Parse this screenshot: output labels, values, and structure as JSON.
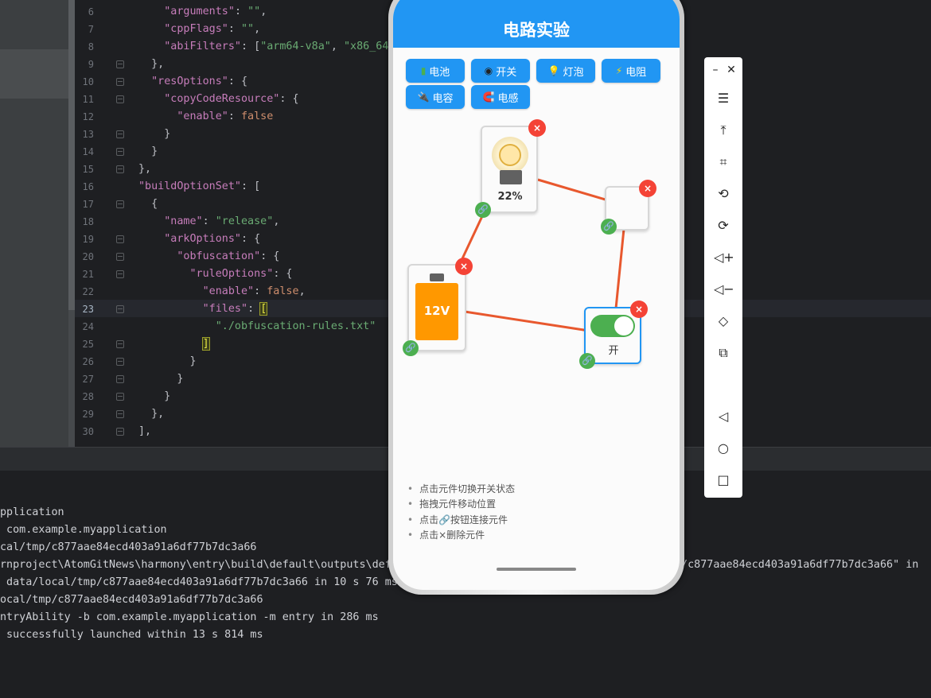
{
  "ide": {
    "code_lines": [
      {
        "n": "6",
        "html": "    <span class=\"k\">\"arguments\"</span><span class=\"p\">: </span><span class=\"s\">\"\"</span><span class=\"p\">,</span>"
      },
      {
        "n": "7",
        "html": "    <span class=\"k\">\"cppFlags\"</span><span class=\"p\">: </span><span class=\"s\">\"\"</span><span class=\"p\">,</span>"
      },
      {
        "n": "8",
        "html": "    <span class=\"k\">\"abiFilters\"</span><span class=\"p\">: [</span><span class=\"s\">\"arm64-v8a\"</span><span class=\"p\">, </span><span class=\"s\">\"x86_64</span>"
      },
      {
        "n": "9",
        "html": "  <span class=\"p\">},</span>"
      },
      {
        "n": "10",
        "html": "  <span class=\"k\">\"resOptions\"</span><span class=\"p\">: {</span>"
      },
      {
        "n": "11",
        "html": "    <span class=\"k\">\"copyCodeResource\"</span><span class=\"p\">: {</span>"
      },
      {
        "n": "12",
        "html": "      <span class=\"k\">\"enable\"</span><span class=\"p\">: </span><span class=\"b\">false</span>"
      },
      {
        "n": "13",
        "html": "    <span class=\"p\">}</span>"
      },
      {
        "n": "14",
        "html": "  <span class=\"p\">}</span>"
      },
      {
        "n": "15",
        "html": "<span class=\"p\">},</span>"
      },
      {
        "n": "16",
        "html": "<span class=\"k\">\"buildOptionSet\"</span><span class=\"p\">: [</span>"
      },
      {
        "n": "17",
        "html": "  <span class=\"p\">{</span>"
      },
      {
        "n": "18",
        "html": "    <span class=\"k\">\"name\"</span><span class=\"p\">: </span><span class=\"s\">\"release\"</span><span class=\"p\">,</span>"
      },
      {
        "n": "19",
        "html": "    <span class=\"k\">\"arkOptions\"</span><span class=\"p\">: {</span>"
      },
      {
        "n": "20",
        "html": "      <span class=\"k\">\"obfuscation\"</span><span class=\"p\">: {</span>"
      },
      {
        "n": "21",
        "html": "        <span class=\"k\">\"ruleOptions\"</span><span class=\"p\">: {</span>"
      },
      {
        "n": "22",
        "html": "          <span class=\"k\">\"enable\"</span><span class=\"p\">: </span><span class=\"b\">false</span><span class=\"p\">,</span>"
      },
      {
        "n": "23",
        "html": "          <span class=\"k\">\"files\"</span><span class=\"p\">: </span><span class=\"mark\">[</span>"
      },
      {
        "n": "24",
        "html": "            <span class=\"s\">\"./obfuscation-rules.txt\"</span>"
      },
      {
        "n": "25",
        "html": "          <span class=\"mark\">]</span>"
      },
      {
        "n": "26",
        "html": "        <span class=\"p\">}</span>"
      },
      {
        "n": "27",
        "html": "      <span class=\"p\">}</span>"
      },
      {
        "n": "28",
        "html": "    <span class=\"p\">}</span>"
      },
      {
        "n": "29",
        "html": "  <span class=\"p\">},</span>"
      },
      {
        "n": "30",
        "html": "<span class=\"p\">],</span>"
      }
    ],
    "console_lines": [
      "pplication",
      " com.example.myapplication",
      "cal/tmp/c877aae84ecd403a91a6df77b7dc3a66",
      "rnproject\\AtomGitNews\\harmony\\entry\\build\\default\\outputs\\def",
      " data/local/tmp/c877aae84ecd403a91a6df77b7dc3a66 in 10 s 76 ms",
      "ocal/tmp/c877aae84ecd403a91a6df77b7dc3a66",
      "ntryAbility -b com.example.myapplication -m entry in 286 ms",
      " successfully launched within 13 s 814 ms"
    ],
    "console_right": "p/c877aae84ecd403a91a6df77b7dc3a66\" in"
  },
  "app": {
    "title": "电路实验",
    "toolbar": [
      {
        "label": "电池",
        "icon": "battery-icon",
        "glyph": "▮"
      },
      {
        "label": "开关",
        "icon": "switch-icon",
        "glyph": "◉"
      },
      {
        "label": "灯泡",
        "icon": "bulb-icon",
        "glyph": "💡"
      },
      {
        "label": "电阻",
        "icon": "lightning-icon",
        "glyph": "⚡"
      },
      {
        "label": "电容",
        "icon": "plug-icon",
        "glyph": "🔌"
      },
      {
        "label": "电感",
        "icon": "magnet-icon",
        "glyph": "🧲"
      }
    ],
    "components": {
      "bulb": {
        "brightness": "22%"
      },
      "battery": {
        "voltage": "12V"
      },
      "switch": {
        "state": "开"
      }
    },
    "delete_glyph": "×",
    "link_glyph": "🔗",
    "tips": [
      "点击元件切换开关状态",
      "拖拽元件移动位置",
      "点击🔗按钮连接元件",
      "点击×删除元件"
    ]
  },
  "colors": {
    "accent": "#2196f3",
    "wire": "#e8582e",
    "delete": "#f44336",
    "connect": "#4caf50",
    "battery": "#ff9800"
  },
  "emulator_toolbar": {
    "icons": [
      "minimize-icon",
      "close-icon",
      "menu-icon",
      "pin-top-icon",
      "crop-icon",
      "rotate-icon",
      "rotate-alt-icon",
      "volume-up-icon",
      "volume-down-icon",
      "shake-icon",
      "screenshot-icon",
      "back-icon",
      "home-icon",
      "recent-icon"
    ]
  }
}
